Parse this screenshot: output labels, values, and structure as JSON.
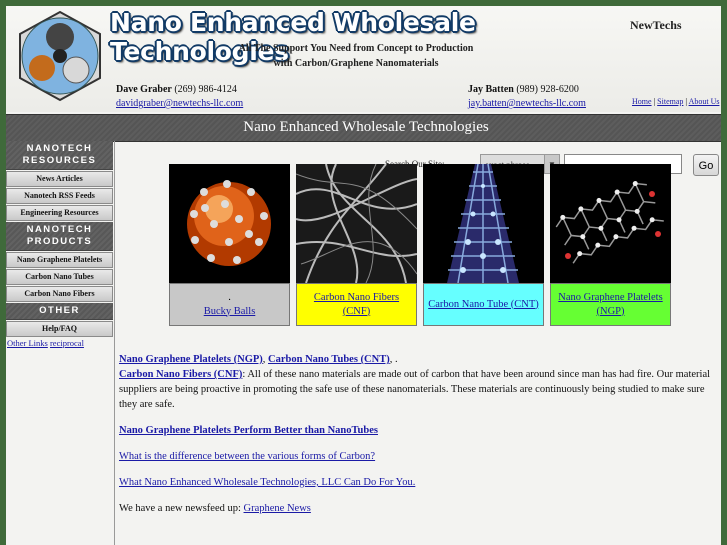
{
  "header": {
    "title": "Nano Enhanced Wholesale Technologies",
    "brand": "NewTechs",
    "tagline1": "All The Support You Need from Concept to Production",
    "tagline2": "with Carbon/Graphene Nanomaterials",
    "contact1": {
      "name": "Dave Graber",
      "phone": " (269) 986-4124 ",
      "email": "davidgraber@newtechs-llc.com"
    },
    "contact2": {
      "name": "Jay Batten",
      "phone": " (989) 928-6200",
      "email": "jay.batten@newtechs-llc.com"
    },
    "links": {
      "home": "Home",
      "sitemap": "Sitemap",
      "about": "About Us",
      "sep": " | "
    }
  },
  "band": {
    "title": "Nano Enhanced Wholesale Technologies"
  },
  "sidebar": {
    "sections": [
      {
        "title": "NANOTECH RESOURCES",
        "items": [
          "News Articles",
          "Nanotech RSS Feeds",
          "Engineering Resources"
        ]
      },
      {
        "title": "NANOTECH PRODUCTS",
        "items": [
          "Nano Graphene Platelets",
          "Carbon Nano Tubes",
          "Carbon Nano Fibers"
        ]
      },
      {
        "title": "OTHER",
        "items": [
          "Help/FAQ"
        ]
      }
    ],
    "other_links": "Other Links",
    "reciprocal": "reciprocal"
  },
  "search": {
    "label": "Search Our Site:",
    "mode": "exact phrase",
    "go": "Go"
  },
  "cards": [
    {
      "caption": "Bucky Balls",
      "dot": ".",
      "color": "#c8c8c8"
    },
    {
      "caption": "Carbon Nano Fibers (CNF)",
      "color": "#ffff00"
    },
    {
      "caption": "Carbon Nano Tube (CNT)",
      "color": "#66ffff"
    },
    {
      "caption": "Nano Graphene Platelets (NGP)",
      "color": "#66ff33"
    }
  ],
  "content": {
    "lead_links": [
      "Nano Graphene Platelets (NGP)",
      "Carbon Nano Tubes (CNT)",
      "Carbon Nano Fibers (CNF)"
    ],
    "lead_text": "All of these nano materials are made out of carbon that have been around since man has had fire. Our material suppliers are being proactive in promoting the safe use of these nanomaterials. These materials are continuously being studied to make sure they are safe.",
    "link_perform": "Nano Graphene Platelets Perform Better than NanoTubes",
    "link_difference": "What is the difference between the various forms of Carbon?",
    "link_whatcan": "What Nano Enhanced Wholesale Technologies, LLC Can Do For You.",
    "newsfeed_text": "We have a new newsfeed up: ",
    "newsfeed_link": "Graphene News"
  }
}
